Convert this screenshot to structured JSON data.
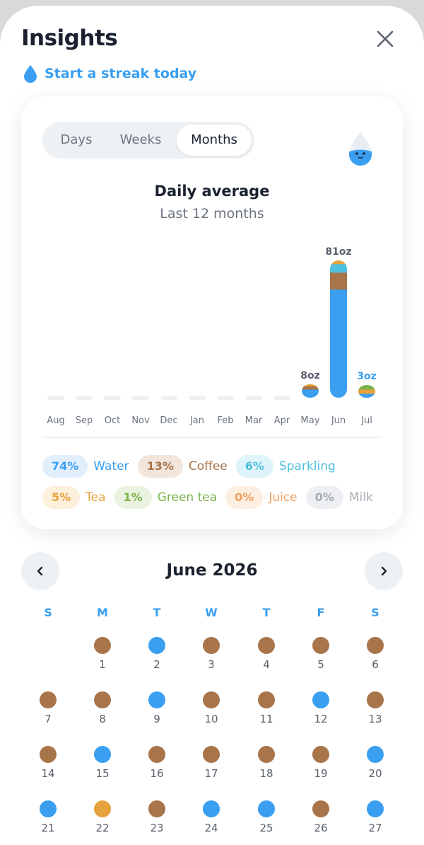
{
  "header": {
    "title": "Insights",
    "streak_text": "Start a streak today"
  },
  "colors": {
    "accent": "#3a9ff0",
    "water": "#3a9ff0",
    "coffee": "#a8744a",
    "sparkling": "#4fc0df",
    "tea": "#e6a23c",
    "green_tea": "#7cb24a",
    "juice": "#f0a060",
    "milk": "#a6adb7",
    "empty": "#eef1f4"
  },
  "tabs": {
    "days": "Days",
    "weeks": "Weeks",
    "months": "Months",
    "active": "Months"
  },
  "chart_data": {
    "type": "bar",
    "title": "Daily average",
    "subtitle": "Last 12 months",
    "categories": [
      "Aug",
      "Sep",
      "Oct",
      "Nov",
      "Dec",
      "Jan",
      "Feb",
      "Mar",
      "Apr",
      "May",
      "Jun",
      "Jul"
    ],
    "totals": [
      0,
      0,
      0,
      0,
      0,
      0,
      0,
      0,
      0,
      8,
      81,
      3
    ],
    "data_labels": [
      "",
      "",
      "",
      "",
      "",
      "",
      "",
      "",
      "",
      "8oz",
      "81oz",
      "3oz"
    ],
    "unit": "oz",
    "series": [
      {
        "name": "Water",
        "values": [
          0,
          0,
          0,
          0,
          0,
          0,
          0,
          0,
          0,
          5,
          64,
          1
        ]
      },
      {
        "name": "Coffee",
        "values": [
          0,
          0,
          0,
          0,
          0,
          0,
          0,
          0,
          0,
          2,
          10,
          0
        ]
      },
      {
        "name": "Sparkling",
        "values": [
          0,
          0,
          0,
          0,
          0,
          0,
          0,
          0,
          0,
          0,
          5,
          0
        ]
      },
      {
        "name": "Tea",
        "values": [
          0,
          0,
          0,
          0,
          0,
          0,
          0,
          0,
          0,
          1,
          2,
          1
        ]
      },
      {
        "name": "Green tea",
        "values": [
          0,
          0,
          0,
          0,
          0,
          0,
          0,
          0,
          0,
          0,
          0,
          1
        ]
      }
    ],
    "ylim": [
      0,
      81
    ]
  },
  "legend": [
    {
      "key": "water",
      "pct": "74%",
      "label": "Water"
    },
    {
      "key": "coffee",
      "pct": "13%",
      "label": "Coffee"
    },
    {
      "key": "sparkling",
      "pct": "6%",
      "label": "Sparkling"
    },
    {
      "key": "tea",
      "pct": "5%",
      "label": "Tea"
    },
    {
      "key": "green_tea",
      "pct": "1%",
      "label": "Green tea"
    },
    {
      "key": "juice",
      "pct": "0%",
      "label": "Juice"
    },
    {
      "key": "milk",
      "pct": "0%",
      "label": "Milk"
    }
  ],
  "calendar": {
    "month_label": "June 2026",
    "weekdays": [
      "S",
      "M",
      "T",
      "W",
      "T",
      "F",
      "S"
    ],
    "first_weekday_index": 1,
    "days": [
      {
        "day": "1",
        "drink": "coffee"
      },
      {
        "day": "2",
        "drink": "water"
      },
      {
        "day": "3",
        "drink": "coffee"
      },
      {
        "day": "4",
        "drink": "coffee"
      },
      {
        "day": "5",
        "drink": "coffee"
      },
      {
        "day": "6",
        "drink": "coffee"
      },
      {
        "day": "7",
        "drink": "coffee"
      },
      {
        "day": "8",
        "drink": "coffee"
      },
      {
        "day": "9",
        "drink": "water"
      },
      {
        "day": "10",
        "drink": "coffee"
      },
      {
        "day": "11",
        "drink": "coffee"
      },
      {
        "day": "12",
        "drink": "water"
      },
      {
        "day": "13",
        "drink": "coffee"
      },
      {
        "day": "14",
        "drink": "coffee"
      },
      {
        "day": "15",
        "drink": "water"
      },
      {
        "day": "16",
        "drink": "coffee"
      },
      {
        "day": "17",
        "drink": "coffee"
      },
      {
        "day": "18",
        "drink": "coffee"
      },
      {
        "day": "19",
        "drink": "coffee"
      },
      {
        "day": "20",
        "drink": "water"
      },
      {
        "day": "21",
        "drink": "water"
      },
      {
        "day": "22",
        "drink": "tea"
      },
      {
        "day": "23",
        "drink": "coffee"
      },
      {
        "day": "24",
        "drink": "water"
      },
      {
        "day": "25",
        "drink": "water"
      },
      {
        "day": "26",
        "drink": "coffee"
      },
      {
        "day": "27",
        "drink": "water"
      }
    ]
  }
}
